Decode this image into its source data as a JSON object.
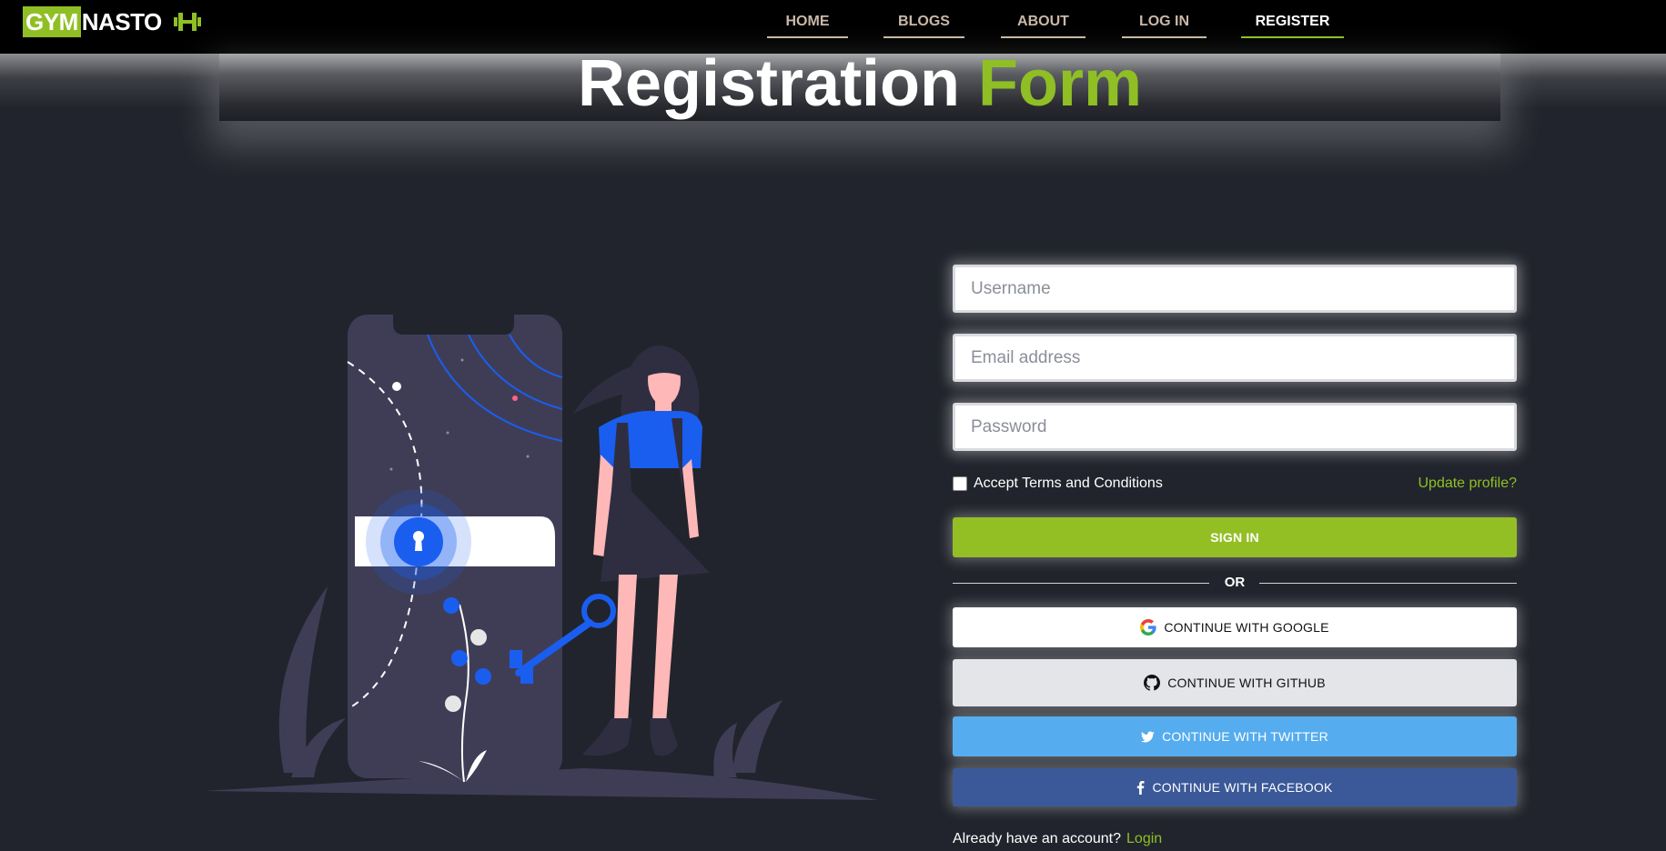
{
  "brand": {
    "part1": "GYM",
    "part2": "NASTO",
    "icon": "dumbbell-icon",
    "accent_color": "#8fbf24"
  },
  "nav": {
    "items": [
      {
        "label": "HOME"
      },
      {
        "label": "BLOGS"
      },
      {
        "label": "ABOUT"
      },
      {
        "label": "LOG IN"
      },
      {
        "label": "REGISTER",
        "active": true
      }
    ]
  },
  "header": {
    "title_part1": "Registration",
    "title_part2": "Form"
  },
  "form": {
    "username_placeholder": "Username",
    "email_placeholder": "Email address",
    "password_placeholder": "Password",
    "terms_label": "Accept Terms and Conditions",
    "terms_checked": false,
    "update_link": "Update profile?",
    "signin_label": "SIGN IN",
    "or_label": "OR",
    "google_label": "CONTINUE WITH GOOGLE",
    "github_label": "CONTINUE WITH GITHUB",
    "twitter_label": "CONTINUE WITH TWITTER",
    "facebook_label": "CONTINUE WITH FACEBOOK",
    "account_prompt": "Already have an account?",
    "login_link": "Login"
  },
  "colors": {
    "background": "#21242c",
    "accent": "#8fbf24",
    "twitter": "#55acee",
    "facebook": "#3b5998"
  }
}
